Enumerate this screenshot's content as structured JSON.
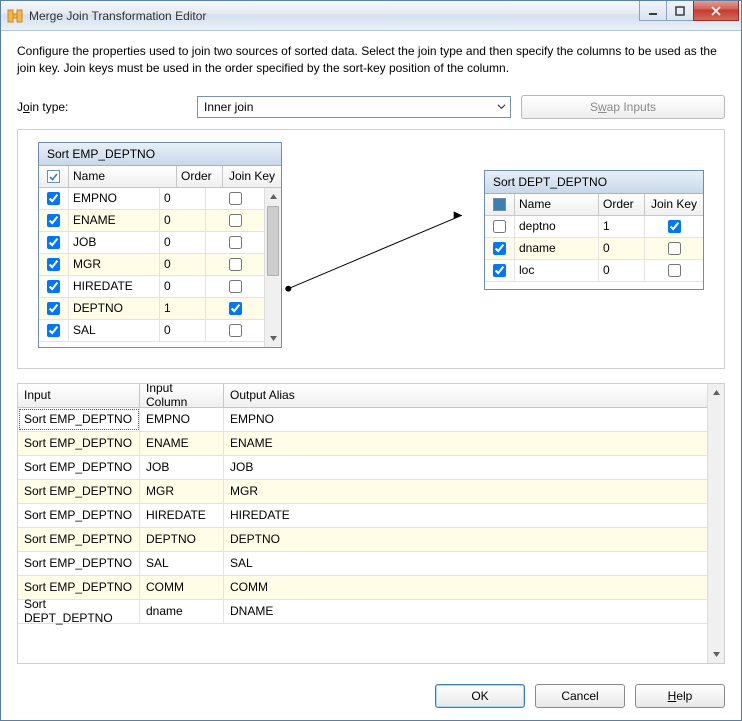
{
  "window": {
    "title": "Merge Join Transformation Editor"
  },
  "description": "Configure the properties used to join two sources of sorted data. Select the join type and then specify the columns to be used as the join key. Join keys must be used in the order specified by the sort-key position of the column.",
  "jointype": {
    "label": "Join type:",
    "value": "Inner join"
  },
  "swap": {
    "label": "Swap Inputs"
  },
  "left": {
    "title": "Sort EMP_DEPTNO",
    "headers": {
      "name": "Name",
      "order": "Order",
      "jkey": "Join Key"
    },
    "rows": [
      {
        "checked": true,
        "name": "EMPNO",
        "order": "0",
        "jkey": false
      },
      {
        "checked": true,
        "name": "ENAME",
        "order": "0",
        "jkey": false
      },
      {
        "checked": true,
        "name": "JOB",
        "order": "0",
        "jkey": false
      },
      {
        "checked": true,
        "name": "MGR",
        "order": "0",
        "jkey": false
      },
      {
        "checked": true,
        "name": "HIREDATE",
        "order": "0",
        "jkey": false
      },
      {
        "checked": true,
        "name": "DEPTNO",
        "order": "1",
        "jkey": true
      },
      {
        "checked": true,
        "name": "SAL",
        "order": "0",
        "jkey": false
      }
    ]
  },
  "right": {
    "title": "Sort DEPT_DEPTNO",
    "headers": {
      "name": "Name",
      "order": "Order",
      "jkey": "Join Key"
    },
    "rows": [
      {
        "checked": false,
        "name": "deptno",
        "order": "1",
        "jkey": true
      },
      {
        "checked": true,
        "name": "dname",
        "order": "0",
        "jkey": false
      },
      {
        "checked": true,
        "name": "loc",
        "order": "0",
        "jkey": false
      }
    ]
  },
  "output": {
    "headers": {
      "input": "Input",
      "col": "Input Column",
      "alias": "Output Alias"
    },
    "rows": [
      {
        "input": "Sort EMP_DEPTNO",
        "col": "EMPNO",
        "alias": "EMPNO"
      },
      {
        "input": "Sort EMP_DEPTNO",
        "col": "ENAME",
        "alias": "ENAME"
      },
      {
        "input": "Sort EMP_DEPTNO",
        "col": "JOB",
        "alias": "JOB"
      },
      {
        "input": "Sort EMP_DEPTNO",
        "col": "MGR",
        "alias": "MGR"
      },
      {
        "input": "Sort EMP_DEPTNO",
        "col": "HIREDATE",
        "alias": "HIREDATE"
      },
      {
        "input": "Sort EMP_DEPTNO",
        "col": "DEPTNO",
        "alias": "DEPTNO"
      },
      {
        "input": "Sort EMP_DEPTNO",
        "col": "SAL",
        "alias": "SAL"
      },
      {
        "input": "Sort EMP_DEPTNO",
        "col": "COMM",
        "alias": "COMM"
      },
      {
        "input": "Sort DEPT_DEPTNO",
        "col": "dname",
        "alias": "DNAME"
      }
    ]
  },
  "buttons": {
    "ok": "OK",
    "cancel": "Cancel",
    "help": "Help"
  }
}
